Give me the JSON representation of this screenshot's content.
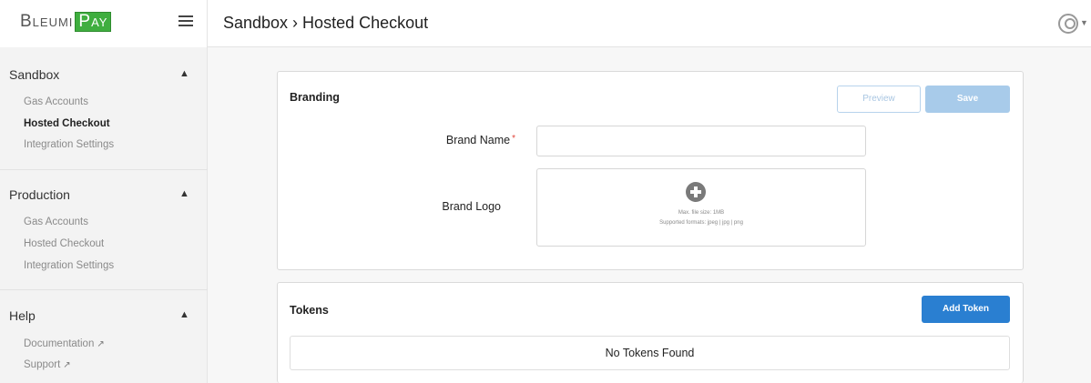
{
  "brand": {
    "part1": "Bleumi",
    "part2": "Pay"
  },
  "header": {
    "breadcrumb": "Sandbox › Hosted Checkout"
  },
  "sidebar": {
    "sections": [
      {
        "title": "Sandbox",
        "items": [
          "Gas Accounts",
          "Hosted Checkout",
          "Integration Settings"
        ]
      },
      {
        "title": "Production",
        "items": [
          "Gas Accounts",
          "Hosted Checkout",
          "Integration Settings"
        ]
      },
      {
        "title": "Help",
        "items": [
          "Documentation",
          "Support"
        ]
      }
    ]
  },
  "branding": {
    "title": "Branding",
    "preview_label": "Preview",
    "save_label": "Save",
    "brand_name_label": "Brand Name",
    "required_mark": "*",
    "brand_logo_label": "Brand Logo",
    "max_size_text": "Max. file size: 1MB",
    "formats_text": "Supported formats: jpeg | jpg | png"
  },
  "tokens": {
    "title": "Tokens",
    "add_label": "Add Token",
    "empty_text": "No Tokens Found"
  },
  "icons": {
    "menu": "hamburger-icon",
    "user": "user-icon",
    "chevron": "chevron-up-icon",
    "external": "external-link-icon",
    "upload": "plus-circle-icon"
  },
  "colors": {
    "brand_green": "#3fae3f",
    "primary_blue": "#2a7fd1",
    "disabled_blue": "#a8cbea",
    "required_red": "#e0453a"
  }
}
